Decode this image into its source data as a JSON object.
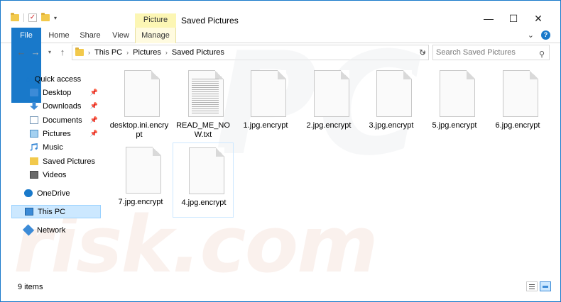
{
  "window": {
    "title": "Saved Pictures",
    "context_tab": "Picture Tools",
    "controls": {
      "minimize": "—",
      "maximize": "☐",
      "close": "✕"
    }
  },
  "ribbon": {
    "tabs": [
      "File",
      "Home",
      "Share",
      "View",
      "Manage"
    ],
    "expand": "⌄",
    "help": "?"
  },
  "address": {
    "crumbs": [
      "This PC",
      "Pictures",
      "Saved Pictures"
    ],
    "search_placeholder": "Search Saved Pictures"
  },
  "nav": {
    "items": [
      {
        "label": "Quick access",
        "icon": "star-icon"
      },
      {
        "label": "Desktop",
        "icon": "desktop-icon",
        "pinned": true
      },
      {
        "label": "Downloads",
        "icon": "download-icon",
        "pinned": true
      },
      {
        "label": "Documents",
        "icon": "documents-icon",
        "pinned": true
      },
      {
        "label": "Pictures",
        "icon": "pictures-icon",
        "pinned": true
      },
      {
        "label": "Music",
        "icon": "music-icon"
      },
      {
        "label": "Saved Pictures",
        "icon": "folder-icon"
      },
      {
        "label": "Videos",
        "icon": "videos-icon"
      },
      {
        "label": "OneDrive",
        "icon": "onedrive-icon"
      },
      {
        "label": "This PC",
        "icon": "this-pc-icon",
        "selected": true
      },
      {
        "label": "Network",
        "icon": "network-icon"
      }
    ]
  },
  "files": [
    {
      "name": "desktop.ini.encrypt",
      "type": "generic"
    },
    {
      "name": "READ_ME_NOW.txt",
      "type": "text"
    },
    {
      "name": "1.jpg.encrypt",
      "type": "generic"
    },
    {
      "name": "2.jpg.encrypt",
      "type": "generic"
    },
    {
      "name": "3.jpg.encrypt",
      "type": "generic"
    },
    {
      "name": "5.jpg.encrypt",
      "type": "generic"
    },
    {
      "name": "6.jpg.encrypt",
      "type": "generic"
    },
    {
      "name": "7.jpg.encrypt",
      "type": "generic"
    },
    {
      "name": "4.jpg.encrypt",
      "type": "generic",
      "selected": true
    }
  ],
  "status": {
    "item_count": "9 items"
  },
  "watermark": {
    "text": "risk.com",
    "logo": "PC"
  }
}
